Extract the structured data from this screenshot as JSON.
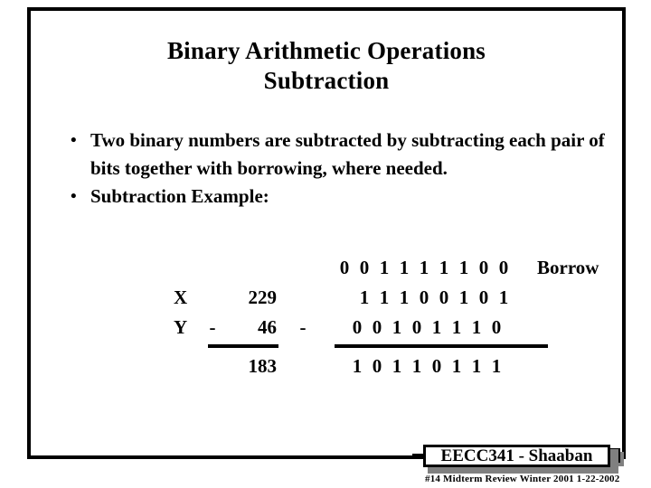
{
  "slide": {
    "title_line1": "Binary Arithmetic Operations",
    "title_line2": "Subtraction",
    "bullets": [
      {
        "marker": "•",
        "text": "Two binary numbers are subtracted by subtracting each pair of bits together with borrowing, where needed."
      },
      {
        "marker": "•",
        "text": "Subtraction Example:"
      }
    ]
  },
  "example": {
    "borrow_label": "Borrow",
    "operator": "-",
    "decimal": {
      "x_label": "X",
      "x_value": "229",
      "y_label": "Y",
      "y_sign": "-",
      "y_value": "46",
      "result_value": "183"
    },
    "binary": {
      "borrow_bits": [
        "0",
        "0",
        "1",
        "1",
        "1",
        "1",
        "1",
        "0",
        "0"
      ],
      "x_bits": [
        "1",
        "1",
        "1",
        "0",
        "0",
        "1",
        "0",
        "1"
      ],
      "y_bits": [
        "0",
        "0",
        "1",
        "0",
        "1",
        "1",
        "1",
        "0"
      ],
      "result_bits": [
        "1",
        "0",
        "1",
        "1",
        "0",
        "1",
        "1",
        "1"
      ]
    }
  },
  "footer": {
    "badge_text": "EECC341 - Shaaban",
    "meta_text": "#14   Midterm Review   Winter 2001   1-22-2002"
  },
  "colors": {
    "text": "#000000",
    "background": "#ffffff",
    "shadow": "#808080"
  }
}
